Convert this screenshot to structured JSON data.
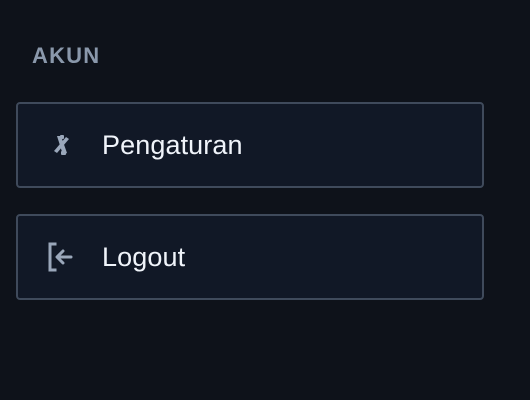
{
  "section": {
    "title": "AKUN"
  },
  "menu": {
    "items": [
      {
        "label": "Pengaturan",
        "icon": "settings-tool-icon"
      },
      {
        "label": "Logout",
        "icon": "logout-icon"
      }
    ]
  },
  "colors": {
    "background": "#0e121a",
    "panel": "#111826",
    "border": "#3f4a5b",
    "section_title": "#8a98ab",
    "text": "#f0f4fa",
    "icon": "#9aa7ba"
  }
}
